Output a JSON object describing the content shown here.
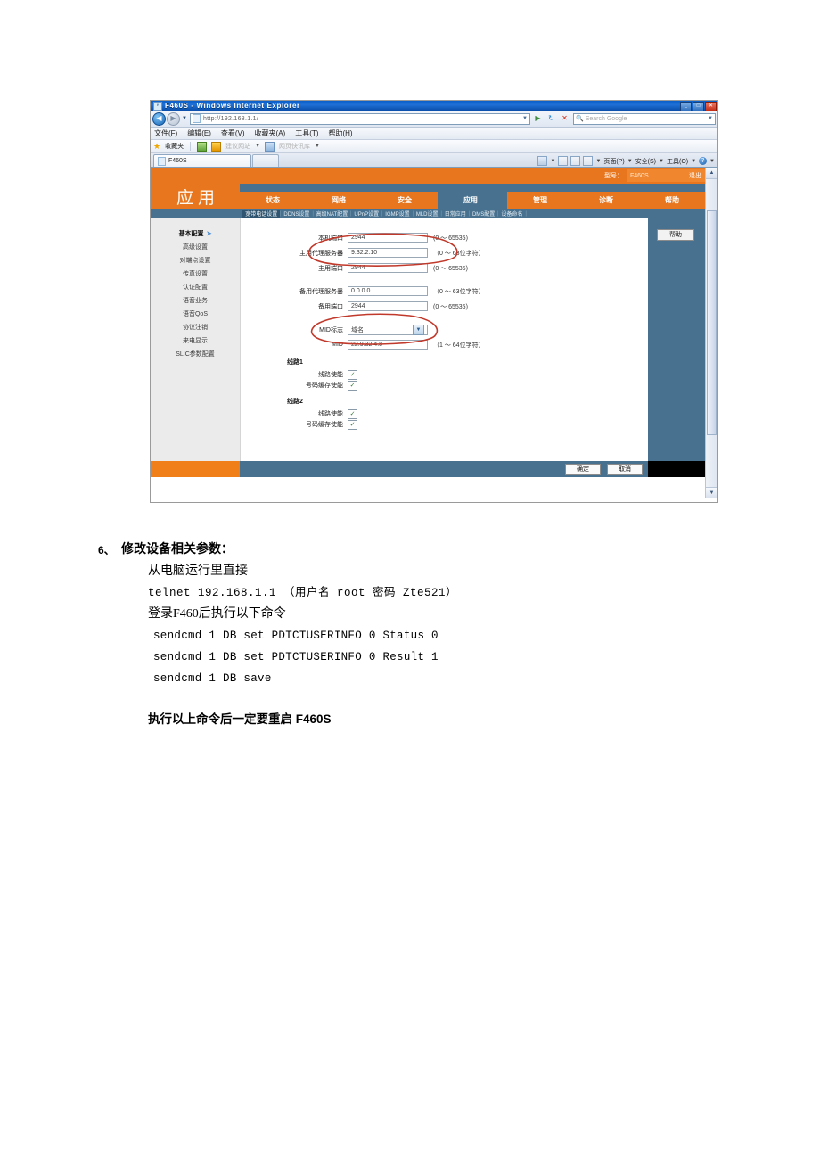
{
  "browser": {
    "title": "F460S - Windows Internet Explorer",
    "url": "http://192.168.1.1/",
    "search_placeholder": "Search Google",
    "window_buttons": {
      "minimize": "_",
      "maximize": "□",
      "close": "✕"
    },
    "menu": [
      "文件(F)",
      "编辑(E)",
      "查看(V)",
      "收藏夹(A)",
      "工具(T)",
      "帮助(H)"
    ],
    "favorites": {
      "label": "收藏夹",
      "items": [
        "建议网站",
        "网页快讯库"
      ]
    },
    "tab_label": "F460S",
    "command_bar": [
      "页面(P)",
      "安全(S)",
      "工具(O)"
    ]
  },
  "router": {
    "model_label": "型号：",
    "model_value": "F460S",
    "logout": "退出",
    "brand": "应用",
    "tabs": [
      {
        "label": "状态",
        "selected": false
      },
      {
        "label": "网络",
        "selected": false
      },
      {
        "label": "安全",
        "selected": false
      },
      {
        "label": "应用",
        "selected": true
      },
      {
        "label": "管理",
        "selected": false
      },
      {
        "label": "诊断",
        "selected": false
      },
      {
        "label": "帮助",
        "selected": false
      }
    ],
    "subnav": [
      {
        "label": "宽带电话设置",
        "selected": true
      },
      {
        "label": "DDNS设置",
        "selected": false
      },
      {
        "label": "高级NAT配置",
        "selected": false
      },
      {
        "label": "UPnP设置",
        "selected": false
      },
      {
        "label": "IGMP设置",
        "selected": false
      },
      {
        "label": "MLD设置",
        "selected": false
      },
      {
        "label": "日常应用",
        "selected": false
      },
      {
        "label": "DMS配置",
        "selected": false
      },
      {
        "label": "设备命名",
        "selected": false
      }
    ],
    "sidebar": [
      {
        "label": "基本配置",
        "selected": true
      },
      {
        "label": "高级设置",
        "selected": false
      },
      {
        "label": "对端点设置",
        "selected": false
      },
      {
        "label": "传真设置",
        "selected": false
      },
      {
        "label": "认证配置",
        "selected": false
      },
      {
        "label": "语音业务",
        "selected": false
      },
      {
        "label": "语音QoS",
        "selected": false
      },
      {
        "label": "协议注销",
        "selected": false
      },
      {
        "label": "来电显示",
        "selected": false
      },
      {
        "label": "SLIC参数配置",
        "selected": false
      }
    ],
    "help_button": "帮助",
    "form": {
      "local_port": {
        "label": "本机端口",
        "value": "2944",
        "hint": "(0 ～ 65535)"
      },
      "primary_proxy": {
        "label": "主用代理服务器",
        "value": "9.32.2.10",
        "hint": "（0 ～ 63位字符）"
      },
      "primary_port": {
        "label": "主用端口",
        "value": "2944",
        "hint": "(0 ～ 65535)"
      },
      "backup_proxy": {
        "label": "备用代理服务器",
        "value": "0.0.0.0",
        "hint": "（0 ～ 63位字符）"
      },
      "backup_port": {
        "label": "备用端口",
        "value": "2944",
        "hint": "(0 ～ 65535)"
      },
      "mid_flag": {
        "label": "MID标志",
        "value": "域名"
      },
      "mid": {
        "label": "MID",
        "value": "22.9.32.4.8",
        "hint": "（1 ～ 64位字符）"
      }
    },
    "lines": [
      {
        "title": "线路1",
        "checks": [
          {
            "label": "线路使能",
            "checked": true,
            "mark": "✓"
          },
          {
            "label": "号码缓存使能",
            "checked": true,
            "mark": "✓"
          }
        ]
      },
      {
        "title": "线路2",
        "checks": [
          {
            "label": "线路使能",
            "checked": true,
            "mark": "✓"
          },
          {
            "label": "号码缓存使能",
            "checked": true,
            "mark": "✓"
          }
        ]
      }
    ],
    "footer": {
      "ok": "确定",
      "cancel": "取消"
    }
  },
  "document": {
    "item_number": "6、",
    "heading": "修改设备相关参数：",
    "line1": "从电脑运行里直接",
    "line2": "telnet    192.168.1.1        （用户名   root     密码    Zte521）",
    "line3": "登录F460后执行以下命令",
    "commands": [
      "sendcmd 1 DB set PDTCTUSERINFO 0 Status 0",
      "sendcmd 1 DB set PDTCTUSERINFO 0 Result 1",
      "sendcmd 1 DB save"
    ],
    "footer_note": "执行以上命令后一定要重启 F460S"
  },
  "colors": {
    "orange": "#e8761e",
    "steel_blue": "#47718f",
    "ink_red": "#c0392b"
  }
}
